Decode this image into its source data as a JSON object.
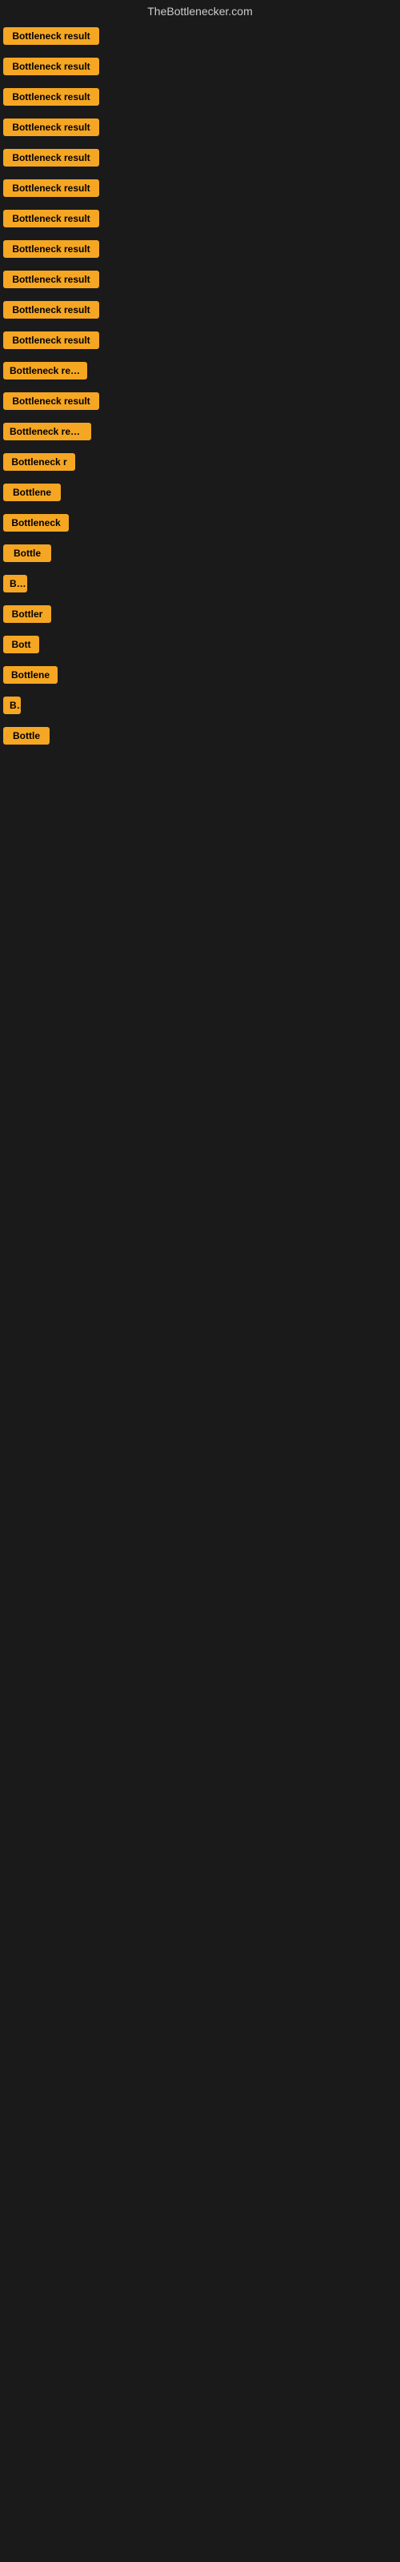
{
  "site": {
    "title": "TheBottlenecker.com"
  },
  "buttons": [
    {
      "id": 1,
      "label": "Bottleneck result",
      "width": 120
    },
    {
      "id": 2,
      "label": "Bottleneck result",
      "width": 120
    },
    {
      "id": 3,
      "label": "Bottleneck result",
      "width": 120
    },
    {
      "id": 4,
      "label": "Bottleneck result",
      "width": 120
    },
    {
      "id": 5,
      "label": "Bottleneck result",
      "width": 120
    },
    {
      "id": 6,
      "label": "Bottleneck result",
      "width": 120
    },
    {
      "id": 7,
      "label": "Bottleneck result",
      "width": 120
    },
    {
      "id": 8,
      "label": "Bottleneck result",
      "width": 120
    },
    {
      "id": 9,
      "label": "Bottleneck result",
      "width": 120
    },
    {
      "id": 10,
      "label": "Bottleneck result",
      "width": 120
    },
    {
      "id": 11,
      "label": "Bottleneck result",
      "width": 120
    },
    {
      "id": 12,
      "label": "Bottleneck result",
      "width": 105
    },
    {
      "id": 13,
      "label": "Bottleneck result",
      "width": 120
    },
    {
      "id": 14,
      "label": "Bottleneck result",
      "width": 110
    },
    {
      "id": 15,
      "label": "Bottleneck r",
      "width": 90
    },
    {
      "id": 16,
      "label": "Bottlene",
      "width": 72
    },
    {
      "id": 17,
      "label": "Bottleneck",
      "width": 82
    },
    {
      "id": 18,
      "label": "Bottle",
      "width": 60
    },
    {
      "id": 19,
      "label": "Bo",
      "width": 30
    },
    {
      "id": 20,
      "label": "Bottler",
      "width": 60
    },
    {
      "id": 21,
      "label": "Bott",
      "width": 45
    },
    {
      "id": 22,
      "label": "Bottlene",
      "width": 68
    },
    {
      "id": 23,
      "label": "B",
      "width": 22
    },
    {
      "id": 24,
      "label": "Bottle",
      "width": 58
    }
  ]
}
